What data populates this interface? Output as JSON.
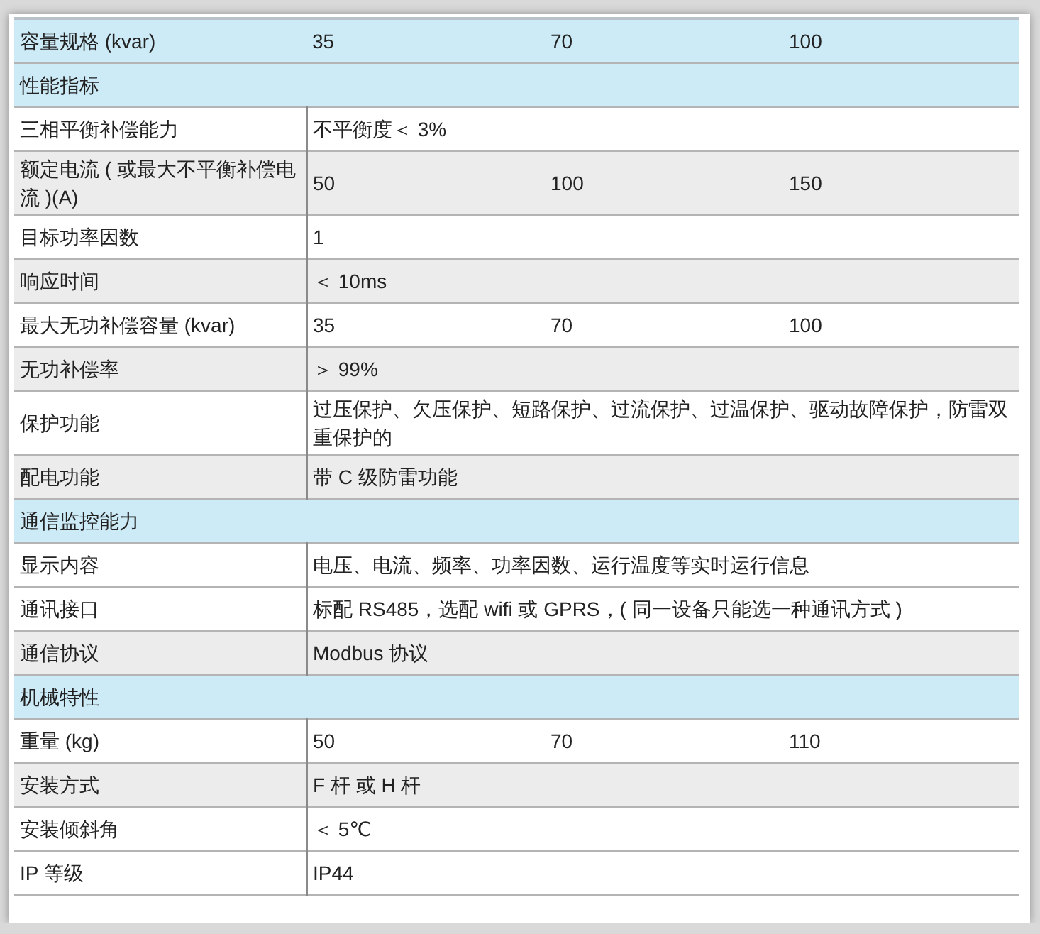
{
  "table": {
    "rows": [
      {
        "kind": "header",
        "label": "容量规格 (kvar)",
        "values": [
          "35",
          "70",
          "100"
        ]
      },
      {
        "kind": "section",
        "label": "性能指标"
      },
      {
        "kind": "spec",
        "shaded": false,
        "label": "三相平衡补偿能力",
        "values": [
          "不平衡度＜ 3%"
        ]
      },
      {
        "kind": "spec",
        "shaded": true,
        "label": "额定电流 ( 或最大不平衡补偿电流 )(A)",
        "values": [
          "50",
          "100",
          "150"
        ]
      },
      {
        "kind": "spec",
        "shaded": false,
        "label": "目标功率因数",
        "values": [
          "1"
        ]
      },
      {
        "kind": "spec",
        "shaded": true,
        "label": "响应时间",
        "values": [
          "＜ 10ms"
        ]
      },
      {
        "kind": "spec",
        "shaded": false,
        "label": "最大无功补偿容量 (kvar)",
        "values": [
          "35",
          "70",
          "100"
        ]
      },
      {
        "kind": "spec",
        "shaded": true,
        "label": "无功补偿率",
        "values": [
          "＞ 99%"
        ]
      },
      {
        "kind": "spec",
        "shaded": false,
        "label": "保护功能",
        "values": [
          "过压保护、欠压保护、短路保护、过流保护、过温保护、驱动故障保护，防雷双重保护的"
        ]
      },
      {
        "kind": "spec",
        "shaded": true,
        "label": "配电功能",
        "values": [
          "带 C 级防雷功能"
        ]
      },
      {
        "kind": "section",
        "label": "通信监控能力"
      },
      {
        "kind": "spec",
        "shaded": false,
        "label": "显示内容",
        "values": [
          "电压、电流、频率、功率因数、运行温度等实时运行信息"
        ]
      },
      {
        "kind": "spec",
        "shaded": false,
        "label": "通讯接口",
        "values": [
          "标配 RS485，选配 wifi 或 GPRS，( 同一设备只能选一种通讯方式 )"
        ]
      },
      {
        "kind": "spec",
        "shaded": true,
        "label": "通信协议",
        "values": [
          "Modbus 协议"
        ]
      },
      {
        "kind": "section",
        "label": "机械特性"
      },
      {
        "kind": "spec",
        "shaded": false,
        "label": "重量 (kg)",
        "values": [
          "50",
          "70",
          "110"
        ]
      },
      {
        "kind": "spec",
        "shaded": true,
        "label": "安装方式",
        "values": [
          "F 杆 或 H 杆"
        ]
      },
      {
        "kind": "spec",
        "shaded": false,
        "label": "安装倾斜角",
        "values": [
          "＜ 5℃"
        ]
      },
      {
        "kind": "spec",
        "shaded": false,
        "label": "IP 等级",
        "values": [
          "IP44"
        ]
      }
    ]
  }
}
